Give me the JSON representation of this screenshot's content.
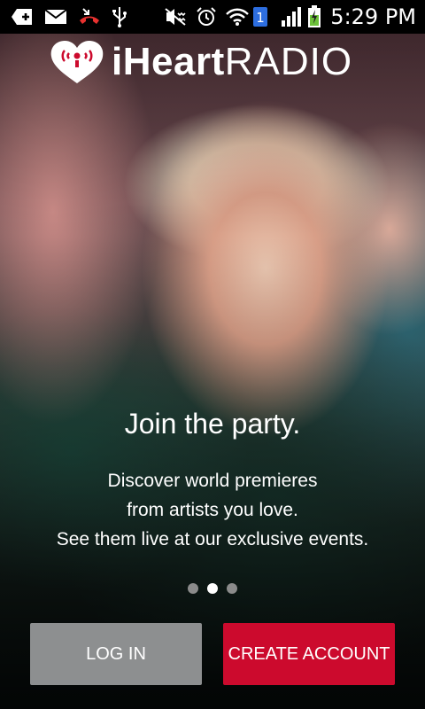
{
  "status_bar": {
    "time": "5:29 PM",
    "battery_charging": true,
    "sim_badge": "1",
    "icons_left": [
      "add-icon",
      "mail-icon",
      "missed-call-icon",
      "usb-icon"
    ],
    "icons_right": [
      "mute-icon",
      "alarm-icon",
      "wifi-icon",
      "sim-icon",
      "signal-icon",
      "battery-icon"
    ]
  },
  "logo": {
    "brand_bold": "iHeart",
    "brand_light": "RADIO"
  },
  "onboarding": {
    "headline": "Join the party.",
    "lines": [
      "Discover world premieres",
      "from artists you love.",
      "See them live at our exclusive events."
    ],
    "page_count": 3,
    "active_page": 2
  },
  "buttons": {
    "login_label": "LOG IN",
    "create_label": "CREATE ACCOUNT"
  },
  "colors": {
    "accent": "#cc0a2d",
    "secondary_button": "#8d8f90",
    "dot_inactive": "#8b8b8b",
    "dot_active": "#ffffff"
  }
}
